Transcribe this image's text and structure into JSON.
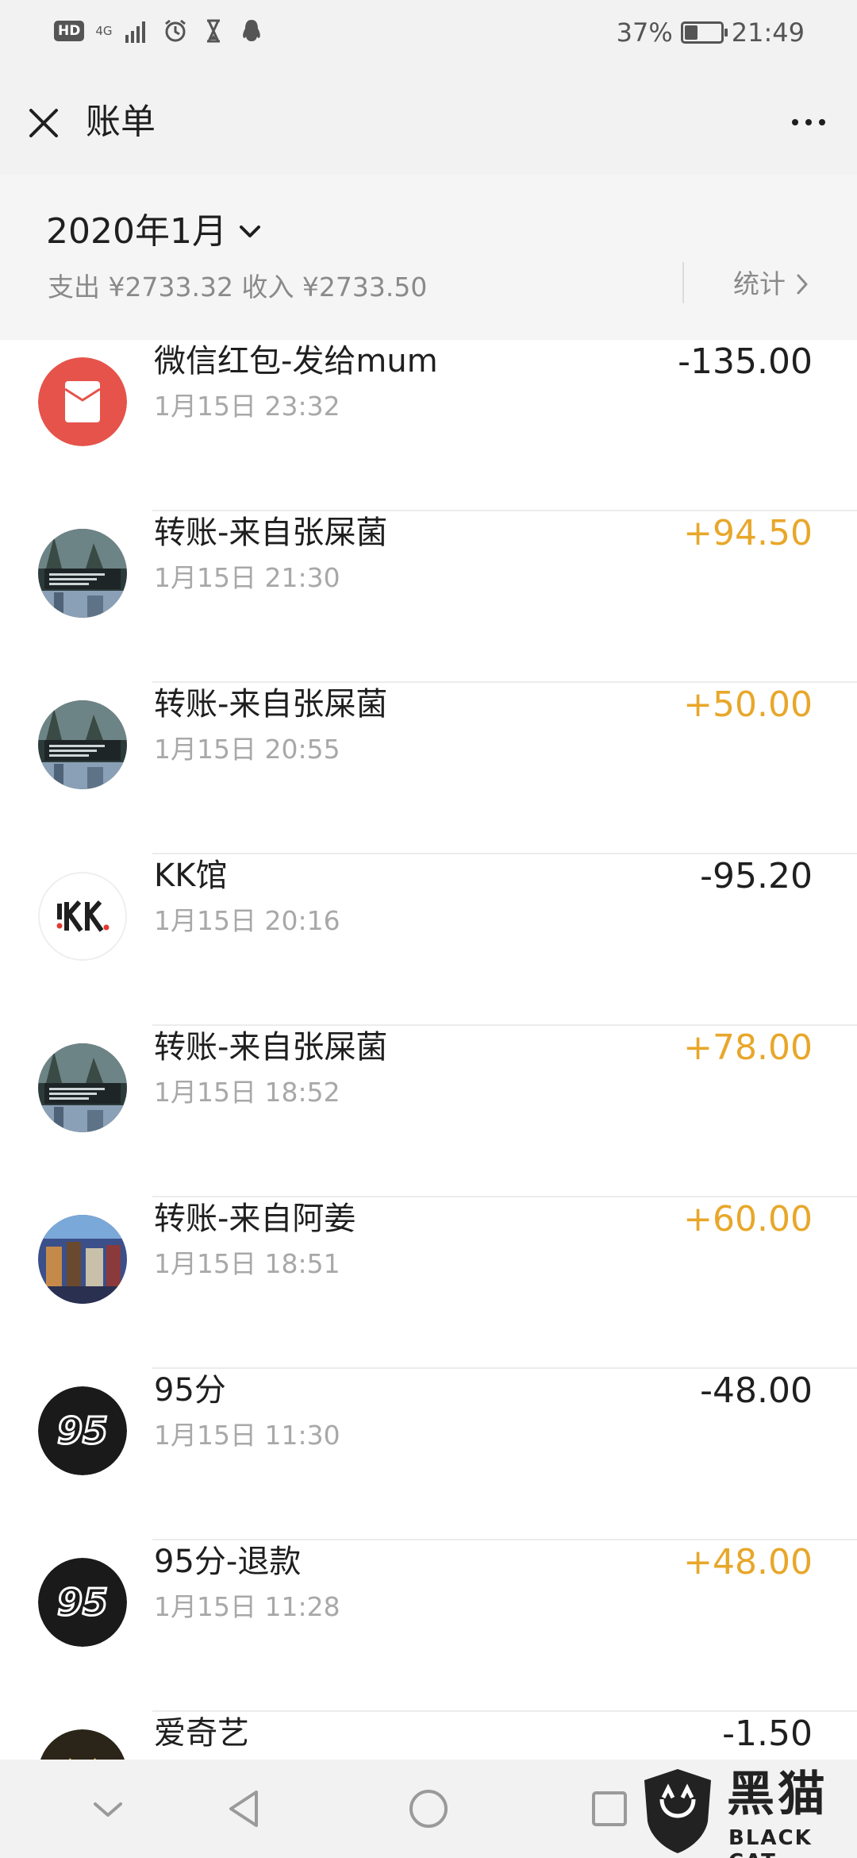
{
  "status_bar": {
    "hd": "HD",
    "network": "4G",
    "battery_percent": "37%",
    "battery_level": 0.37,
    "time": "21:49",
    "icons": [
      "signal-icon",
      "alarm-icon",
      "hourglass-icon",
      "qq-penguin-icon"
    ]
  },
  "header": {
    "title": "账单"
  },
  "month": {
    "label": "2020年1月",
    "summary": "支出 ¥2733.32 收入 ¥2733.50",
    "stats_label": "统计"
  },
  "transactions": [
    {
      "title": "微信红包-发给mum",
      "time": "1月15日 23:32",
      "amount": "-135.00",
      "type": "out",
      "avatar": "red-packet-icon"
    },
    {
      "title": "转账-来自张屎菌",
      "time": "1月15日 21:30",
      "amount": "+94.50",
      "type": "in",
      "avatar": "city-photo-avatar"
    },
    {
      "title": "转账-来自张屎菌",
      "time": "1月15日 20:55",
      "amount": "+50.00",
      "type": "in",
      "avatar": "city-photo-avatar"
    },
    {
      "title": "KK馆",
      "time": "1月15日 20:16",
      "amount": "-95.20",
      "type": "out",
      "avatar": "kk-logo"
    },
    {
      "title": "转账-来自张屎菌",
      "time": "1月15日 18:52",
      "amount": "+78.00",
      "type": "in",
      "avatar": "city-photo-avatar"
    },
    {
      "title": "转账-来自阿姜",
      "time": "1月15日 18:51",
      "amount": "+60.00",
      "type": "in",
      "avatar": "game-photo-avatar"
    },
    {
      "title": "95分",
      "time": "1月15日 11:30",
      "amount": "-48.00",
      "type": "out",
      "avatar": "95-logo"
    },
    {
      "title": "95分-退款",
      "time": "1月15日 11:28",
      "amount": "+48.00",
      "type": "in",
      "avatar": "95-logo"
    },
    {
      "title": "爱奇艺",
      "time": "",
      "amount": "-1.50",
      "type": "out",
      "avatar": "iqiyi-logo"
    }
  ],
  "watermark": {
    "text": "黑猫",
    "sub": "BLACK CAT"
  },
  "colors": {
    "income": "#e8a72a",
    "red_packet": "#e5534b",
    "header_bg": "#f2f2f2"
  }
}
